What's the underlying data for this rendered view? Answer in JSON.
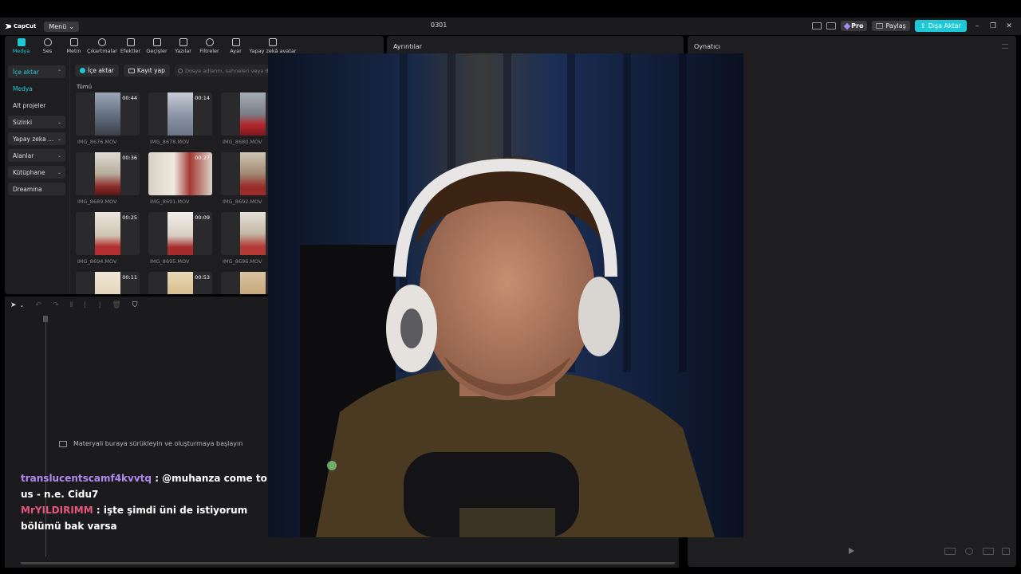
{
  "titlebar": {
    "app_name": "CapCut",
    "menu_label": "Menü",
    "project_title": "0301",
    "pro_label": "Pro",
    "share_label": "Paylaş",
    "export_label": "Dışa Aktar",
    "colors": {
      "accent": "#1ec8d4",
      "pro": "#a78bfa"
    }
  },
  "tools": [
    {
      "label": "Medya",
      "icon": "media-icon"
    },
    {
      "label": "Ses",
      "icon": "audio-icon"
    },
    {
      "label": "Metin",
      "icon": "text-icon"
    },
    {
      "label": "Çıkartmalar",
      "icon": "sticker-icon"
    },
    {
      "label": "Efektler",
      "icon": "effects-icon"
    },
    {
      "label": "Geçişler",
      "icon": "transitions-icon"
    },
    {
      "label": "Yazılar",
      "icon": "captions-icon"
    },
    {
      "label": "Filtreler",
      "icon": "filters-icon"
    },
    {
      "label": "Ayar",
      "icon": "adjust-icon"
    },
    {
      "label": "Yapay zekâ avatar",
      "icon": "ai-avatar-icon"
    }
  ],
  "side_nav": {
    "import": "İçe aktar",
    "media": "Medya",
    "sub_projects": "Alt projeler",
    "yours": "Sizinki",
    "ai": "Yapay zeka ...",
    "spaces": "Alanlar",
    "library": "Kütüphane",
    "dreamina": "Dreamina"
  },
  "import_row": {
    "import_btn": "İçe aktar",
    "record_btn": "Kayıt yap",
    "search_placeholder": "Dosya adlarını, sahneleri veya diyalogları ara"
  },
  "all_label": "Tümü",
  "media_items": [
    {
      "name": "IMG_8676.MOV",
      "duration": "00:44"
    },
    {
      "name": "IMG_8678.MOV",
      "duration": "00:14"
    },
    {
      "name": "IMG_8680.MOV",
      "duration": ""
    },
    {
      "name": "IMG_8689.MOV",
      "duration": "00:36"
    },
    {
      "name": "IMG_8691.MOV",
      "duration": "00:27"
    },
    {
      "name": "IMG_8692.MOV",
      "duration": ""
    },
    {
      "name": "IMG_8694.MOV",
      "duration": "00:25"
    },
    {
      "name": "IMG_8695.MOV",
      "duration": "00:09"
    },
    {
      "name": "IMG_8696.MOV",
      "duration": ""
    },
    {
      "name": "",
      "duration": "00:11"
    },
    {
      "name": "",
      "duration": "00:53"
    },
    {
      "name": "",
      "duration": ""
    }
  ],
  "timeline": {
    "drop_hint": "Materyali buraya sürükleyin ve oluşturmaya başlayın"
  },
  "chat": [
    {
      "user": "translucentscamf4kvvtq",
      "message": " : @muhanza come to us - n.e. Cidu7"
    },
    {
      "user": "MrYILDIRIMM",
      "message": " : işte şimdi üni de istiyorum bölümü bak varsa"
    }
  ],
  "details_title": "Ayrıntılar",
  "player_title": "Oynatıcı"
}
